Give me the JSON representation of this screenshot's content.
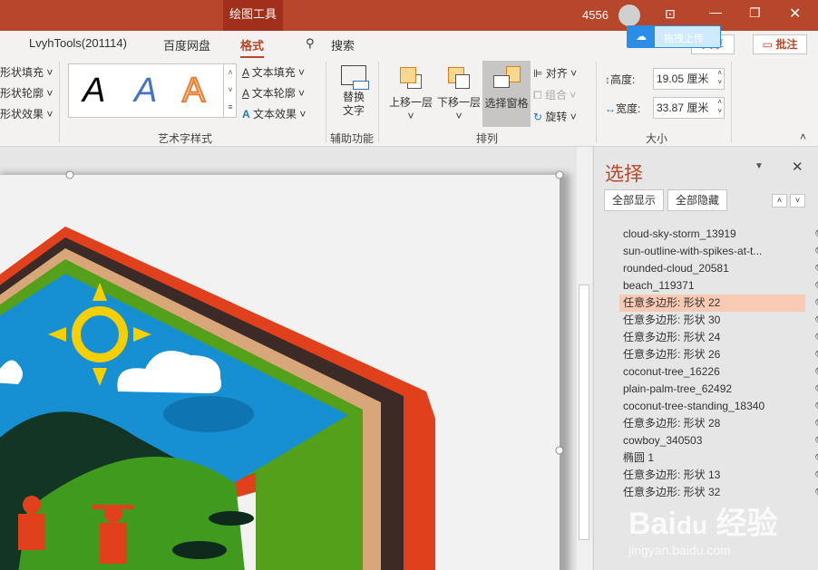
{
  "titlebar": {
    "tool_tab": "绘图工具",
    "user": "4556",
    "baidu_upload": "拖拽上传"
  },
  "tabs": [
    {
      "label": "LvyhTools(201114)"
    },
    {
      "label": "百度网盘"
    },
    {
      "label": "格式",
      "active": true
    },
    {
      "label": "搜索"
    }
  ],
  "share": "共享",
  "comment": "批注",
  "ribbon": {
    "shape_styles": [
      "形状填充",
      "形状轮廓",
      "形状效果"
    ],
    "wordart": {
      "label": "艺术字样式",
      "text_items": [
        "文本填充",
        "文本轮廓",
        "文本效果"
      ],
      "sample": "A"
    },
    "accessibility": {
      "label": "辅助功能",
      "alt_text": "替换文字"
    },
    "arrange": {
      "label": "排列",
      "bring_forward": "上移一层",
      "send_backward": "下移一层",
      "selection_pane": "选择窗格",
      "align": "对齐",
      "group": "组合",
      "rotate": "旋转"
    },
    "size": {
      "label": "大小",
      "height_label": "高度:",
      "height": "19.05 厘米",
      "width_label": "宽度:",
      "width": "33.87 厘米"
    }
  },
  "pane": {
    "title": "选择",
    "show_all": "全部显示",
    "hide_all": "全部隐藏",
    "items": [
      "cloud-sky-storm_13919",
      "sun-outline-with-spikes-at-t...",
      "rounded-cloud_20581",
      "beach_119371",
      "任意多边形: 形状 22",
      "任意多边形: 形状 30",
      "任意多边形: 形状 24",
      "任意多边形: 形状 26",
      "coconut-tree_16226",
      "plain-palm-tree_62492",
      "coconut-tree-standing_18340",
      "任意多边形: 形状 28",
      "cowboy_340503",
      "椭圆 1",
      "任意多边形: 形状 13",
      "任意多边形: 形状 32"
    ],
    "selected_index": 4
  },
  "watermark": "Baidu经验 jingyan.baidu.com",
  "colors": {
    "accent": "#b7472a",
    "selected": "#f8c9b3"
  }
}
